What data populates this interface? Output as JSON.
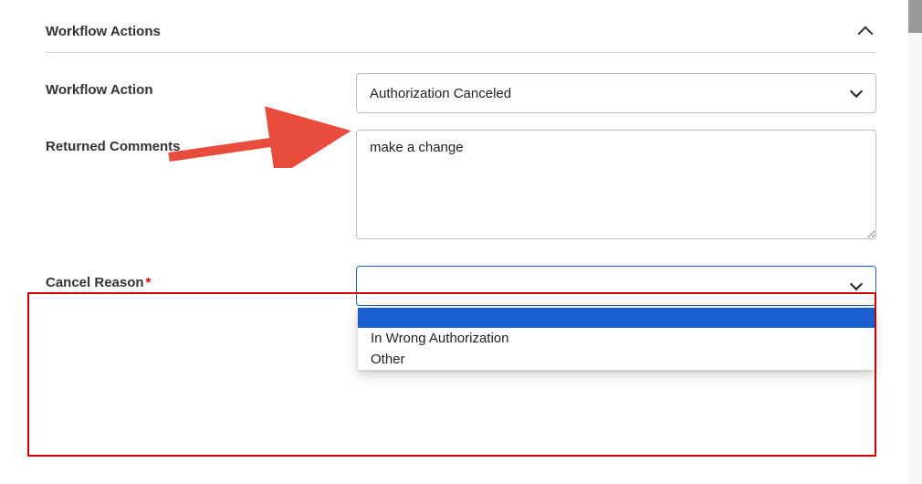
{
  "section": {
    "title": "Workflow Actions"
  },
  "form": {
    "workflow_action": {
      "label": "Workflow Action",
      "value": "Authorization Canceled"
    },
    "returned_comments": {
      "label": "Returned Comments",
      "value": "make a change"
    },
    "cancel_reason": {
      "label": "Cancel Reason",
      "value": "",
      "options": [
        {
          "label": "",
          "highlighted": true
        },
        {
          "label": "In Wrong Authorization",
          "highlighted": false
        },
        {
          "label": "Other",
          "highlighted": false
        }
      ]
    }
  }
}
